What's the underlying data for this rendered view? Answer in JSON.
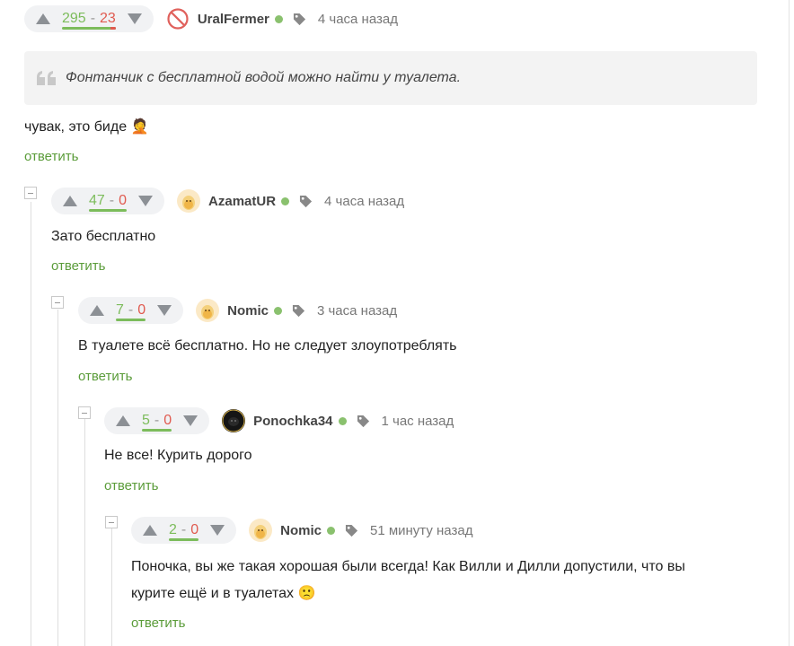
{
  "comments": [
    {
      "plus": "295",
      "sep": "-",
      "minus": "23",
      "user": "UralFermer",
      "time": "4 часа назад",
      "quote": "Фонтанчик с бесплатной водой можно найти у туалета.",
      "text": "чувак, это биде 🤦",
      "reply": "ответить",
      "avatar": "ban-icon"
    },
    {
      "plus": "47",
      "sep": "-",
      "minus": "0",
      "user": "AzamatUR",
      "time": "4 часа назад",
      "text": "Зато бесплатно",
      "reply": "ответить",
      "avatar": "egg-avatar"
    },
    {
      "plus": "7",
      "sep": "-",
      "minus": "0",
      "user": "Nomic",
      "time": "3 часа назад",
      "text": "В туалете всё бесплатно. Но не следует злоупотреблять",
      "reply": "ответить",
      "avatar": "egg-avatar"
    },
    {
      "plus": "5",
      "sep": "-",
      "minus": "0",
      "user": "Ponochka34",
      "time": "1 час назад",
      "text": "Не все! Курить дорого",
      "reply": "ответить",
      "avatar": "dark-avatar"
    },
    {
      "plus": "2",
      "sep": "-",
      "minus": "0",
      "user": "Nomic",
      "time": "51 минуту назад",
      "text_line1": "Поночка, вы же такая хорошая были всегда! Как Вилли и Дилли допустили, что вы",
      "text_line2": "курите ещё и в туалетах 🙁",
      "reply": "ответить",
      "avatar": "egg-avatar"
    }
  ],
  "colors": {
    "plus": "#7cbc5b",
    "minus": "#e05a4f",
    "reply": "#5b9c3a",
    "online": "#8ac16e"
  }
}
